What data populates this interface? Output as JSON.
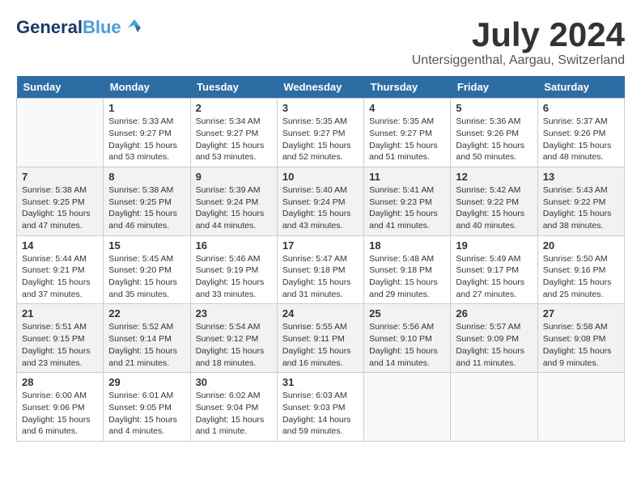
{
  "header": {
    "logo_line1": "General",
    "logo_line2": "Blue",
    "month": "July 2024",
    "location": "Untersiggenthal, Aargau, Switzerland"
  },
  "days_of_week": [
    "Sunday",
    "Monday",
    "Tuesday",
    "Wednesday",
    "Thursday",
    "Friday",
    "Saturday"
  ],
  "weeks": [
    [
      {
        "day": "",
        "info": ""
      },
      {
        "day": "1",
        "info": "Sunrise: 5:33 AM\nSunset: 9:27 PM\nDaylight: 15 hours\nand 53 minutes."
      },
      {
        "day": "2",
        "info": "Sunrise: 5:34 AM\nSunset: 9:27 PM\nDaylight: 15 hours\nand 53 minutes."
      },
      {
        "day": "3",
        "info": "Sunrise: 5:35 AM\nSunset: 9:27 PM\nDaylight: 15 hours\nand 52 minutes."
      },
      {
        "day": "4",
        "info": "Sunrise: 5:35 AM\nSunset: 9:27 PM\nDaylight: 15 hours\nand 51 minutes."
      },
      {
        "day": "5",
        "info": "Sunrise: 5:36 AM\nSunset: 9:26 PM\nDaylight: 15 hours\nand 50 minutes."
      },
      {
        "day": "6",
        "info": "Sunrise: 5:37 AM\nSunset: 9:26 PM\nDaylight: 15 hours\nand 48 minutes."
      }
    ],
    [
      {
        "day": "7",
        "info": "Sunrise: 5:38 AM\nSunset: 9:25 PM\nDaylight: 15 hours\nand 47 minutes."
      },
      {
        "day": "8",
        "info": "Sunrise: 5:38 AM\nSunset: 9:25 PM\nDaylight: 15 hours\nand 46 minutes."
      },
      {
        "day": "9",
        "info": "Sunrise: 5:39 AM\nSunset: 9:24 PM\nDaylight: 15 hours\nand 44 minutes."
      },
      {
        "day": "10",
        "info": "Sunrise: 5:40 AM\nSunset: 9:24 PM\nDaylight: 15 hours\nand 43 minutes."
      },
      {
        "day": "11",
        "info": "Sunrise: 5:41 AM\nSunset: 9:23 PM\nDaylight: 15 hours\nand 41 minutes."
      },
      {
        "day": "12",
        "info": "Sunrise: 5:42 AM\nSunset: 9:22 PM\nDaylight: 15 hours\nand 40 minutes."
      },
      {
        "day": "13",
        "info": "Sunrise: 5:43 AM\nSunset: 9:22 PM\nDaylight: 15 hours\nand 38 minutes."
      }
    ],
    [
      {
        "day": "14",
        "info": "Sunrise: 5:44 AM\nSunset: 9:21 PM\nDaylight: 15 hours\nand 37 minutes."
      },
      {
        "day": "15",
        "info": "Sunrise: 5:45 AM\nSunset: 9:20 PM\nDaylight: 15 hours\nand 35 minutes."
      },
      {
        "day": "16",
        "info": "Sunrise: 5:46 AM\nSunset: 9:19 PM\nDaylight: 15 hours\nand 33 minutes."
      },
      {
        "day": "17",
        "info": "Sunrise: 5:47 AM\nSunset: 9:18 PM\nDaylight: 15 hours\nand 31 minutes."
      },
      {
        "day": "18",
        "info": "Sunrise: 5:48 AM\nSunset: 9:18 PM\nDaylight: 15 hours\nand 29 minutes."
      },
      {
        "day": "19",
        "info": "Sunrise: 5:49 AM\nSunset: 9:17 PM\nDaylight: 15 hours\nand 27 minutes."
      },
      {
        "day": "20",
        "info": "Sunrise: 5:50 AM\nSunset: 9:16 PM\nDaylight: 15 hours\nand 25 minutes."
      }
    ],
    [
      {
        "day": "21",
        "info": "Sunrise: 5:51 AM\nSunset: 9:15 PM\nDaylight: 15 hours\nand 23 minutes."
      },
      {
        "day": "22",
        "info": "Sunrise: 5:52 AM\nSunset: 9:14 PM\nDaylight: 15 hours\nand 21 minutes."
      },
      {
        "day": "23",
        "info": "Sunrise: 5:54 AM\nSunset: 9:12 PM\nDaylight: 15 hours\nand 18 minutes."
      },
      {
        "day": "24",
        "info": "Sunrise: 5:55 AM\nSunset: 9:11 PM\nDaylight: 15 hours\nand 16 minutes."
      },
      {
        "day": "25",
        "info": "Sunrise: 5:56 AM\nSunset: 9:10 PM\nDaylight: 15 hours\nand 14 minutes."
      },
      {
        "day": "26",
        "info": "Sunrise: 5:57 AM\nSunset: 9:09 PM\nDaylight: 15 hours\nand 11 minutes."
      },
      {
        "day": "27",
        "info": "Sunrise: 5:58 AM\nSunset: 9:08 PM\nDaylight: 15 hours\nand 9 minutes."
      }
    ],
    [
      {
        "day": "28",
        "info": "Sunrise: 6:00 AM\nSunset: 9:06 PM\nDaylight: 15 hours\nand 6 minutes."
      },
      {
        "day": "29",
        "info": "Sunrise: 6:01 AM\nSunset: 9:05 PM\nDaylight: 15 hours\nand 4 minutes."
      },
      {
        "day": "30",
        "info": "Sunrise: 6:02 AM\nSunset: 9:04 PM\nDaylight: 15 hours\nand 1 minute."
      },
      {
        "day": "31",
        "info": "Sunrise: 6:03 AM\nSunset: 9:03 PM\nDaylight: 14 hours\nand 59 minutes."
      },
      {
        "day": "",
        "info": ""
      },
      {
        "day": "",
        "info": ""
      },
      {
        "day": "",
        "info": ""
      }
    ]
  ]
}
